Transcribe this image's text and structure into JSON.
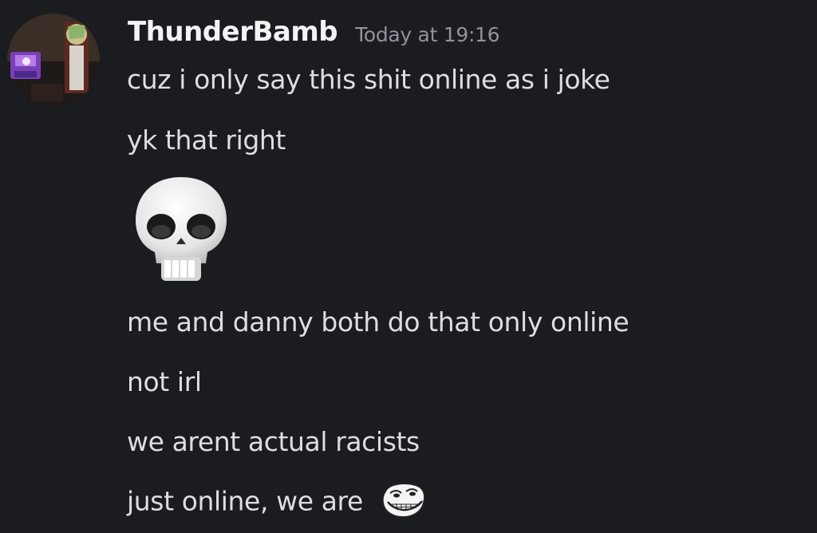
{
  "message": {
    "author": "ThunderBamb",
    "timestamp": "Today at 19:16",
    "avatar_icon": "avatar-icon",
    "lines": [
      "cuz i only say this shit online as i joke",
      "yk that right",
      "me and danny both do that only online",
      "not irl",
      "we arent actual racists",
      "just online, we are"
    ],
    "emoji_skull": "skull-emoji",
    "emoji_troll": "trollface-emoji"
  },
  "colors": {
    "background": "#1b1c20",
    "username": "#f2f3f5",
    "timestamp": "#8f939b",
    "text": "#dcdee3"
  }
}
